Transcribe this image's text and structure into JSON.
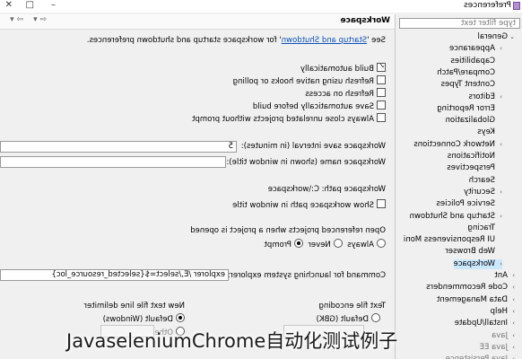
{
  "window": {
    "title": "Preferences",
    "controls": [
      "–",
      "□",
      "✕"
    ]
  },
  "filter": {
    "placeholder": "type filter text"
  },
  "tree": {
    "items": [
      {
        "label": "General",
        "arrow": "⌄"
      },
      {
        "label": "Appearance",
        "arrow": "›"
      },
      {
        "label": "Capabilities",
        "arrow": ""
      },
      {
        "label": "Compare/Patch",
        "arrow": ""
      },
      {
        "label": "Content Types",
        "arrow": ""
      },
      {
        "label": "Editors",
        "arrow": "›"
      },
      {
        "label": "Error Reporting",
        "arrow": ""
      },
      {
        "label": "Globalization",
        "arrow": ""
      },
      {
        "label": "Keys",
        "arrow": ""
      },
      {
        "label": "Network Connections",
        "arrow": "›"
      },
      {
        "label": "Notifications",
        "arrow": ""
      },
      {
        "label": "Perspectives",
        "arrow": ""
      },
      {
        "label": "Search",
        "arrow": ""
      },
      {
        "label": "Security",
        "arrow": "›"
      },
      {
        "label": "Service Policies",
        "arrow": ""
      },
      {
        "label": "Startup and Shutdown",
        "arrow": "›"
      },
      {
        "label": "Tracing",
        "arrow": ""
      },
      {
        "label": "UI Responsiveness Moni",
        "arrow": ""
      },
      {
        "label": "Web Browser",
        "arrow": ""
      },
      {
        "label": "Workspace",
        "arrow": "›"
      },
      {
        "label": "Ant",
        "arrow": "›"
      },
      {
        "label": "Code Recommenders",
        "arrow": "›"
      },
      {
        "label": "Data Management",
        "arrow": "›"
      },
      {
        "label": "Help",
        "arrow": "›"
      },
      {
        "label": "Install/Update",
        "arrow": "›"
      },
      {
        "label": "Java",
        "arrow": "›"
      },
      {
        "label": "Java EE",
        "arrow": "›"
      },
      {
        "label": "Java Persistence",
        "arrow": "›"
      }
    ]
  },
  "page": {
    "title": "Workspace",
    "intro_prefix": "See '",
    "intro_link": "Startup and Shutdown",
    "intro_suffix": "' for workspace startup and shutdown preferences.",
    "checkboxes": [
      {
        "label": "Build automatically",
        "checked": true
      },
      {
        "label": "Refresh using native hooks or polling",
        "checked": false
      },
      {
        "label": "Refresh on access",
        "checked": false
      },
      {
        "label": "Save automatically before build",
        "checked": false
      },
      {
        "label": "Always close unrelated projects without prompt",
        "checked": false
      }
    ],
    "save_interval_label": "Workspace save interval (in minutes):",
    "save_interval_value": "5",
    "workspace_name_label": "Workspace name (shown in window title):",
    "workspace_name_value": "",
    "workspace_path": "Workspace path:  C:\\workspace",
    "show_path_label": "Show workspace path in window title",
    "open_ref_label": "Open referenced projects when a project is opened",
    "open_ref_options": [
      "Always",
      "Never",
      "Prompt"
    ],
    "open_ref_selected": "Prompt",
    "command_label": "Command for launching system explorer:",
    "command_value": "explorer /E,/select=${selected_resource_loc}",
    "encoding_label": "Text file encoding",
    "encoding_default": "Default (GBK)",
    "delimiter_label": "New text file line delimiter",
    "delimiter_default": "Default (Windows)",
    "other_label": "Other:"
  },
  "watermark": "JavaseleniumChrome自动化测试例子"
}
